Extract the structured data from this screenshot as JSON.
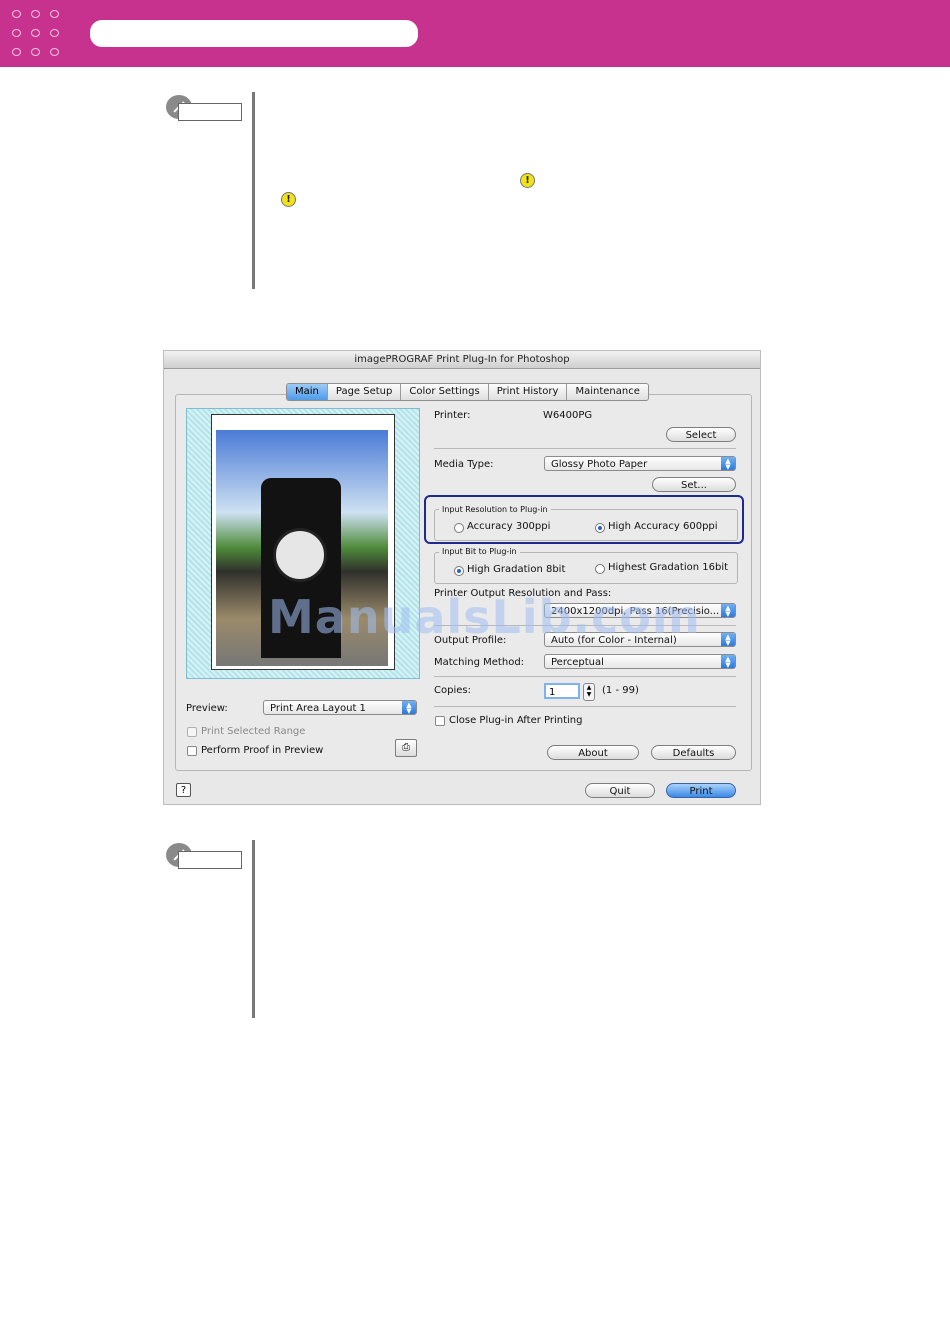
{
  "dialog": {
    "title": "imagePROGRAF Print Plug-In for Photoshop",
    "tabs": [
      "Main",
      "Page Setup",
      "Color Settings",
      "Print History",
      "Maintenance"
    ],
    "printer_label": "Printer:",
    "printer_value": "W6400PG",
    "select_button": "Select",
    "media_type_label": "Media Type:",
    "media_type_value": "Glossy Photo Paper",
    "set_button": "Set...",
    "input_resolution_title": "Input Resolution to Plug-in",
    "resolution_options": [
      "Accuracy 300ppi",
      "High Accuracy 600ppi"
    ],
    "input_bit_title": "Input Bit to Plug-in",
    "bit_options": [
      "High Gradation 8bit",
      "Highest Gradation 16bit"
    ],
    "output_resolution_label": "Printer Output Resolution and Pass:",
    "output_resolution_value": "2400x1200dpi, Pass 16(Precisio...",
    "output_profile_label": "Output Profile:",
    "output_profile_value": "Auto (for Color - Internal)",
    "matching_method_label": "Matching Method:",
    "matching_method_value": "Perceptual",
    "copies_label": "Copies:",
    "copies_value": "1",
    "copies_range": "(1 - 99)",
    "close_after_print": "Close Plug-in After Printing",
    "about_button": "About",
    "defaults_button": "Defaults",
    "preview_label": "Preview:",
    "preview_value": "Print Area Layout 1",
    "print_selected_range": "Print Selected Range",
    "perform_proof": "Perform Proof in Preview",
    "quit_button": "Quit",
    "print_button": "Print",
    "help_icon": "?"
  },
  "watermark": "ManualsLib.com",
  "colors": {
    "banner": "#c8328f",
    "highlight": "#1f2a8f",
    "default_button": "#3a8ae8"
  }
}
